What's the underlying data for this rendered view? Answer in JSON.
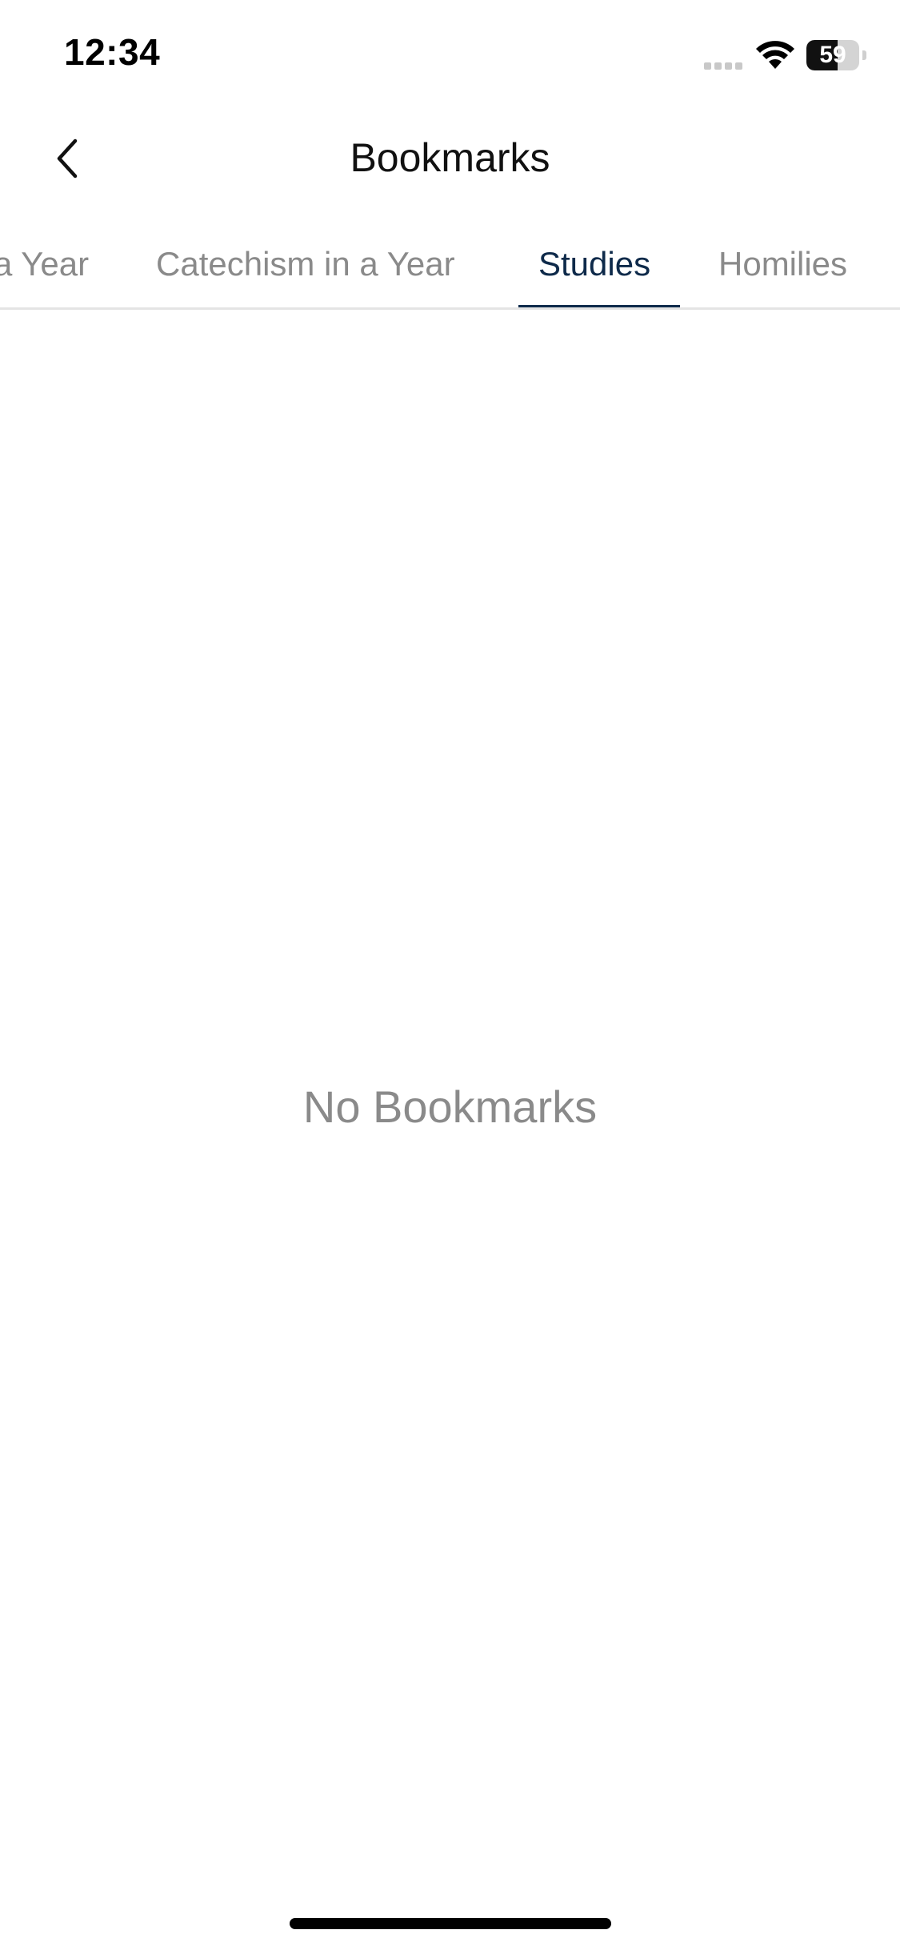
{
  "status_bar": {
    "time": "12:34",
    "battery_level": "59",
    "battery_fraction": 0.59,
    "wifi_icon": "wifi-icon",
    "signal_icon": "cellular-signal-icon"
  },
  "nav": {
    "title": "Bookmarks",
    "back_icon": "chevron-left-icon"
  },
  "tabs": [
    {
      "label": "a Year",
      "active": false
    },
    {
      "label": "Catechism in a Year",
      "active": false
    },
    {
      "label": "Studies",
      "active": true
    },
    {
      "label": "Homilies",
      "active": false
    }
  ],
  "empty_state": {
    "message": "No Bookmarks"
  },
  "colors": {
    "accent": "#0e2a4a",
    "inactive_tab": "#8a8a8a",
    "empty_text": "#8a8a8a"
  }
}
